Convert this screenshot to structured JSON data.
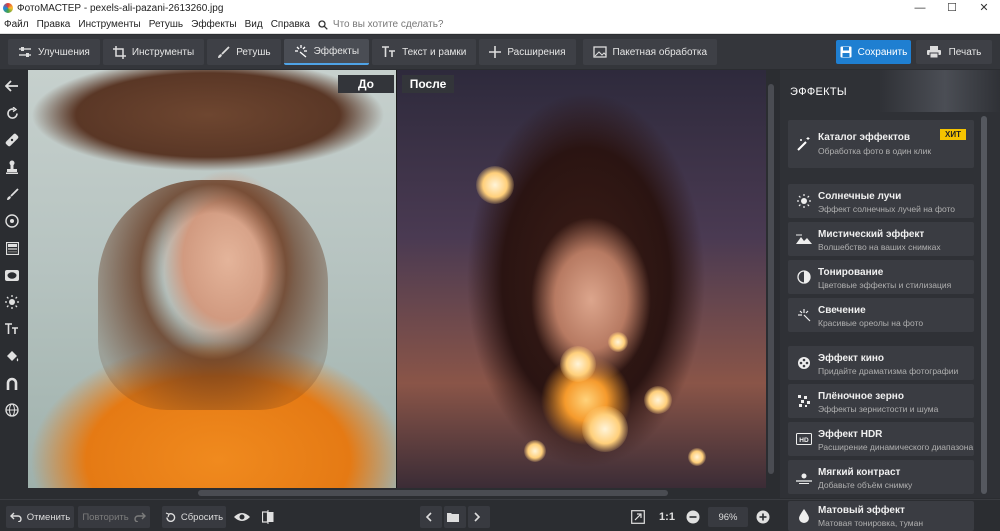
{
  "window": {
    "title": "ФотоМАСТЕР - pexels-ali-pazani-2613260.jpg",
    "controls": [
      "—",
      "☐",
      "✕"
    ]
  },
  "menu": {
    "items": [
      "Файл",
      "Правка",
      "Инструменты",
      "Ретушь",
      "Эффекты",
      "Вид",
      "Справка"
    ],
    "search_placeholder": "Что вы хотите сделать?"
  },
  "toolbar": {
    "tabs": [
      {
        "label": "Улучшения",
        "icon": "sliders-icon"
      },
      {
        "label": "Инструменты",
        "icon": "crop-icon"
      },
      {
        "label": "Ретушь",
        "icon": "brush-icon"
      },
      {
        "label": "Эффекты",
        "icon": "sparkle-icon",
        "active": true
      },
      {
        "label": "Текст и рамки",
        "icon": "text-icon"
      },
      {
        "label": "Расширения",
        "icon": "plus-icon"
      }
    ],
    "batch_label": "Пакетная обработка",
    "save_label": "Сохранить",
    "print_label": "Печать",
    "accent_color": "#1f7fd1"
  },
  "compare": {
    "before_label": "До",
    "after_label": "После"
  },
  "panel": {
    "title": "ЭФФЕКТЫ",
    "catalog": {
      "title": "Каталог эффектов",
      "subtitle": "Обработка фото в один клик",
      "badge": "ХИТ"
    },
    "effects": [
      {
        "title": "Солнечные лучи",
        "subtitle": "Эффект солнечных лучей на фото",
        "icon": "sun-icon"
      },
      {
        "title": "Мистический эффект",
        "subtitle": "Волшебство на ваших снимках",
        "icon": "mountain-icon"
      },
      {
        "title": "Тонирование",
        "subtitle": "Цветовые эффекты и стилизация",
        "icon": "half-circle-icon"
      },
      {
        "title": "Свечение",
        "subtitle": "Красивые ореолы на фото",
        "icon": "glow-icon"
      },
      {
        "title": "Эффект кино",
        "subtitle": "Придайте драматизма фотографии",
        "icon": "film-reel-icon"
      },
      {
        "title": "Плёночное зерно",
        "subtitle": "Эффекты зернистости и шума",
        "icon": "grain-icon"
      },
      {
        "title": "Эффект HDR",
        "subtitle": "Расширение динамического диапазона",
        "icon": "hdr-icon"
      },
      {
        "title": "Мягкий контраст",
        "subtitle": "Добавьте объём снимку",
        "icon": "soft-contrast-icon"
      },
      {
        "title": "Матовый эффект",
        "subtitle": "Матовая тонировка, туман",
        "icon": "drop-icon"
      }
    ]
  },
  "bottom": {
    "undo_label": "Отменить",
    "redo_label": "Повторить",
    "reset_label": "Сбросить",
    "ratio_label": "1:1",
    "zoom_value": "96%"
  }
}
